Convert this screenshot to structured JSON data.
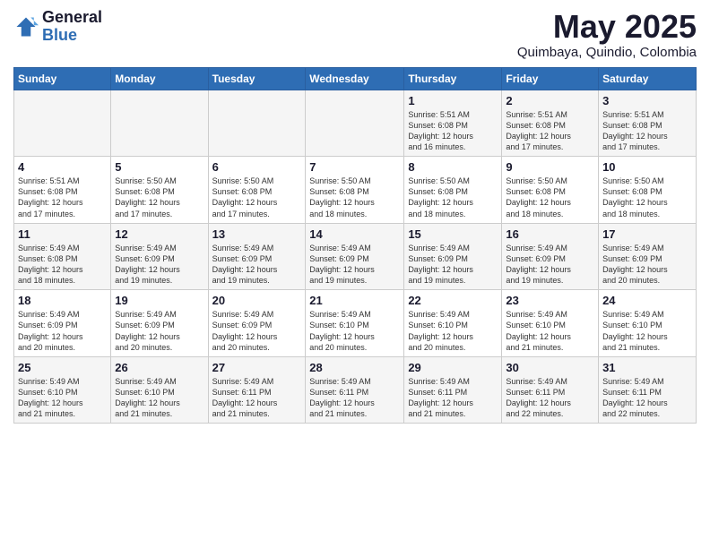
{
  "logo": {
    "general": "General",
    "blue": "Blue"
  },
  "title": "May 2025",
  "subtitle": "Quimbaya, Quindio, Colombia",
  "days_of_week": [
    "Sunday",
    "Monday",
    "Tuesday",
    "Wednesday",
    "Thursday",
    "Friday",
    "Saturday"
  ],
  "weeks": [
    [
      {
        "day": "",
        "info": ""
      },
      {
        "day": "",
        "info": ""
      },
      {
        "day": "",
        "info": ""
      },
      {
        "day": "",
        "info": ""
      },
      {
        "day": "1",
        "info": "Sunrise: 5:51 AM\nSunset: 6:08 PM\nDaylight: 12 hours\nand 16 minutes."
      },
      {
        "day": "2",
        "info": "Sunrise: 5:51 AM\nSunset: 6:08 PM\nDaylight: 12 hours\nand 17 minutes."
      },
      {
        "day": "3",
        "info": "Sunrise: 5:51 AM\nSunset: 6:08 PM\nDaylight: 12 hours\nand 17 minutes."
      }
    ],
    [
      {
        "day": "4",
        "info": "Sunrise: 5:51 AM\nSunset: 6:08 PM\nDaylight: 12 hours\nand 17 minutes."
      },
      {
        "day": "5",
        "info": "Sunrise: 5:50 AM\nSunset: 6:08 PM\nDaylight: 12 hours\nand 17 minutes."
      },
      {
        "day": "6",
        "info": "Sunrise: 5:50 AM\nSunset: 6:08 PM\nDaylight: 12 hours\nand 17 minutes."
      },
      {
        "day": "7",
        "info": "Sunrise: 5:50 AM\nSunset: 6:08 PM\nDaylight: 12 hours\nand 18 minutes."
      },
      {
        "day": "8",
        "info": "Sunrise: 5:50 AM\nSunset: 6:08 PM\nDaylight: 12 hours\nand 18 minutes."
      },
      {
        "day": "9",
        "info": "Sunrise: 5:50 AM\nSunset: 6:08 PM\nDaylight: 12 hours\nand 18 minutes."
      },
      {
        "day": "10",
        "info": "Sunrise: 5:50 AM\nSunset: 6:08 PM\nDaylight: 12 hours\nand 18 minutes."
      }
    ],
    [
      {
        "day": "11",
        "info": "Sunrise: 5:49 AM\nSunset: 6:08 PM\nDaylight: 12 hours\nand 18 minutes."
      },
      {
        "day": "12",
        "info": "Sunrise: 5:49 AM\nSunset: 6:09 PM\nDaylight: 12 hours\nand 19 minutes."
      },
      {
        "day": "13",
        "info": "Sunrise: 5:49 AM\nSunset: 6:09 PM\nDaylight: 12 hours\nand 19 minutes."
      },
      {
        "day": "14",
        "info": "Sunrise: 5:49 AM\nSunset: 6:09 PM\nDaylight: 12 hours\nand 19 minutes."
      },
      {
        "day": "15",
        "info": "Sunrise: 5:49 AM\nSunset: 6:09 PM\nDaylight: 12 hours\nand 19 minutes."
      },
      {
        "day": "16",
        "info": "Sunrise: 5:49 AM\nSunset: 6:09 PM\nDaylight: 12 hours\nand 19 minutes."
      },
      {
        "day": "17",
        "info": "Sunrise: 5:49 AM\nSunset: 6:09 PM\nDaylight: 12 hours\nand 20 minutes."
      }
    ],
    [
      {
        "day": "18",
        "info": "Sunrise: 5:49 AM\nSunset: 6:09 PM\nDaylight: 12 hours\nand 20 minutes."
      },
      {
        "day": "19",
        "info": "Sunrise: 5:49 AM\nSunset: 6:09 PM\nDaylight: 12 hours\nand 20 minutes."
      },
      {
        "day": "20",
        "info": "Sunrise: 5:49 AM\nSunset: 6:09 PM\nDaylight: 12 hours\nand 20 minutes."
      },
      {
        "day": "21",
        "info": "Sunrise: 5:49 AM\nSunset: 6:10 PM\nDaylight: 12 hours\nand 20 minutes."
      },
      {
        "day": "22",
        "info": "Sunrise: 5:49 AM\nSunset: 6:10 PM\nDaylight: 12 hours\nand 20 minutes."
      },
      {
        "day": "23",
        "info": "Sunrise: 5:49 AM\nSunset: 6:10 PM\nDaylight: 12 hours\nand 21 minutes."
      },
      {
        "day": "24",
        "info": "Sunrise: 5:49 AM\nSunset: 6:10 PM\nDaylight: 12 hours\nand 21 minutes."
      }
    ],
    [
      {
        "day": "25",
        "info": "Sunrise: 5:49 AM\nSunset: 6:10 PM\nDaylight: 12 hours\nand 21 minutes."
      },
      {
        "day": "26",
        "info": "Sunrise: 5:49 AM\nSunset: 6:10 PM\nDaylight: 12 hours\nand 21 minutes."
      },
      {
        "day": "27",
        "info": "Sunrise: 5:49 AM\nSunset: 6:11 PM\nDaylight: 12 hours\nand 21 minutes."
      },
      {
        "day": "28",
        "info": "Sunrise: 5:49 AM\nSunset: 6:11 PM\nDaylight: 12 hours\nand 21 minutes."
      },
      {
        "day": "29",
        "info": "Sunrise: 5:49 AM\nSunset: 6:11 PM\nDaylight: 12 hours\nand 21 minutes."
      },
      {
        "day": "30",
        "info": "Sunrise: 5:49 AM\nSunset: 6:11 PM\nDaylight: 12 hours\nand 22 minutes."
      },
      {
        "day": "31",
        "info": "Sunrise: 5:49 AM\nSunset: 6:11 PM\nDaylight: 12 hours\nand 22 minutes."
      }
    ]
  ]
}
